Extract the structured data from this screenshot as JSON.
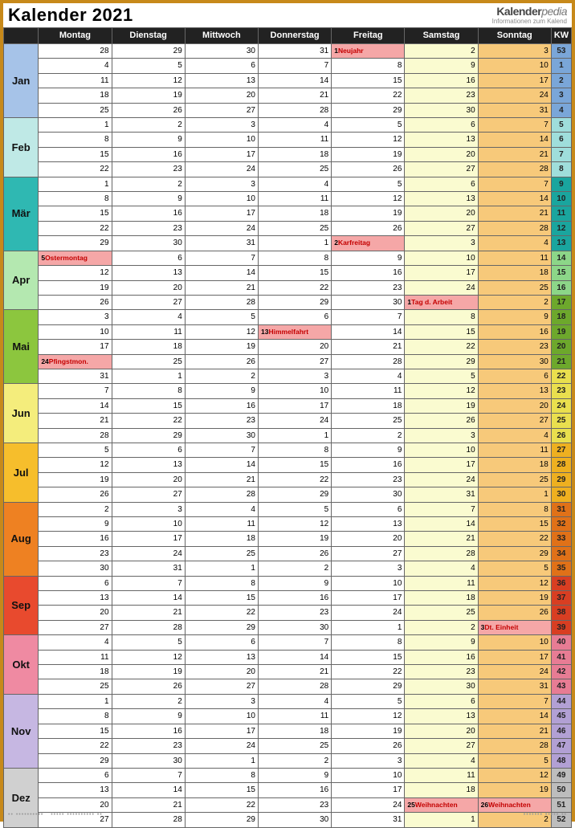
{
  "title": "Kalender 2021",
  "brand_sub": "Informationen zum Kalend",
  "columns": [
    "",
    "Montag",
    "Dienstag",
    "Mittwoch",
    "Donnerstag",
    "Freitag",
    "Samstag",
    "Sonntag",
    "KW"
  ],
  "month_colors": {
    "Jan": "#a6c3e8",
    "Feb": "#bfe9e6",
    "Mär": "#2fb8b2",
    "Apr": "#b4e8b0",
    "Mai": "#8cc63e",
    "Jun": "#f4ed7c",
    "Jul": "#f6be2c",
    "Aug": "#ee8122",
    "Sep": "#e84a2e",
    "Okt": "#ef8aa2",
    "Nov": "#c6b7e2",
    "Dez": "#d0d0d0"
  },
  "kw_colors": {
    "53": "#7aa6d8",
    "1": "#7aa6d8",
    "2": "#7aa6d8",
    "3": "#7aa6d8",
    "4": "#7aa6d8",
    "5": "#9fdedb",
    "6": "#9fdedb",
    "7": "#9fdedb",
    "8": "#9fdedb",
    "9": "#1aa59e",
    "10": "#1aa59e",
    "11": "#1aa59e",
    "12": "#1aa59e",
    "13": "#1aa59e",
    "14": "#8cd688",
    "15": "#8cd688",
    "16": "#8cd688",
    "17": "#6da82c",
    "18": "#6da82c",
    "19": "#6da82c",
    "20": "#6da82c",
    "21": "#6da82c",
    "22": "#e9df4e",
    "23": "#e9df4e",
    "24": "#e9df4e",
    "25": "#e9df4e",
    "26": "#e9df4e",
    "27": "#eeb020",
    "28": "#eeb020",
    "29": "#eeb020",
    "30": "#eeb020",
    "31": "#e07118",
    "32": "#e07118",
    "33": "#e07118",
    "34": "#e07118",
    "35": "#e07118",
    "36": "#d83e22",
    "37": "#d83e22",
    "38": "#d83e22",
    "39": "#d83e22",
    "40": "#e77c94",
    "41": "#e77c94",
    "42": "#e77c94",
    "43": "#e77c94",
    "44": "#b2a0d4",
    "45": "#b2a0d4",
    "46": "#b2a0d4",
    "47": "#b2a0d4",
    "48": "#b2a0d4",
    "49": "#bdbdbd",
    "50": "#bdbdbd",
    "51": "#bdbdbd",
    "52": "#bdbdbd"
  },
  "months": [
    {
      "name": "Jan",
      "rows": [
        {
          "d": [
            "28",
            "29",
            "30",
            "31",
            {
              "n": "1",
              "h": "Neujahr"
            },
            "2",
            "3"
          ],
          "kw": "53"
        },
        {
          "d": [
            "4",
            "5",
            "6",
            "7",
            "8",
            "9",
            "10"
          ],
          "kw": "1"
        },
        {
          "d": [
            "11",
            "12",
            "13",
            "14",
            "15",
            "16",
            "17"
          ],
          "kw": "2"
        },
        {
          "d": [
            "18",
            "19",
            "20",
            "21",
            "22",
            "23",
            "24"
          ],
          "kw": "3"
        },
        {
          "d": [
            "25",
            "26",
            "27",
            "28",
            "29",
            "30",
            "31"
          ],
          "kw": "4"
        }
      ]
    },
    {
      "name": "Feb",
      "rows": [
        {
          "d": [
            "1",
            "2",
            "3",
            "4",
            "5",
            "6",
            "7"
          ],
          "kw": "5"
        },
        {
          "d": [
            "8",
            "9",
            "10",
            "11",
            "12",
            "13",
            "14"
          ],
          "kw": "6"
        },
        {
          "d": [
            "15",
            "16",
            "17",
            "18",
            "19",
            "20",
            "21"
          ],
          "kw": "7"
        },
        {
          "d": [
            "22",
            "23",
            "24",
            "25",
            "26",
            "27",
            "28"
          ],
          "kw": "8"
        }
      ]
    },
    {
      "name": "Mär",
      "rows": [
        {
          "d": [
            "1",
            "2",
            "3",
            "4",
            "5",
            "6",
            "7"
          ],
          "kw": "9"
        },
        {
          "d": [
            "8",
            "9",
            "10",
            "11",
            "12",
            "13",
            "14"
          ],
          "kw": "10"
        },
        {
          "d": [
            "15",
            "16",
            "17",
            "18",
            "19",
            "20",
            "21"
          ],
          "kw": "11"
        },
        {
          "d": [
            "22",
            "23",
            "24",
            "25",
            "26",
            "27",
            "28"
          ],
          "kw": "12"
        },
        {
          "d": [
            "29",
            "30",
            "31",
            "1",
            {
              "n": "2",
              "h": "Karfreitag"
            },
            "3",
            "4"
          ],
          "kw": "13"
        }
      ]
    },
    {
      "name": "Apr",
      "rows": [
        {
          "d": [
            {
              "n": "5",
              "h": "Ostermontag"
            },
            "6",
            "7",
            "8",
            "9",
            "10",
            "11"
          ],
          "kw": "14"
        },
        {
          "d": [
            "12",
            "13",
            "14",
            "15",
            "16",
            "17",
            "18"
          ],
          "kw": "15"
        },
        {
          "d": [
            "19",
            "20",
            "21",
            "22",
            "23",
            "24",
            "25"
          ],
          "kw": "16"
        },
        {
          "d": [
            "26",
            "27",
            "28",
            "29",
            "30",
            {
              "n": "1",
              "h": "Tag d. Arbeit"
            },
            "2"
          ],
          "kw": "17"
        }
      ]
    },
    {
      "name": "Mai",
      "rows": [
        {
          "d": [
            "3",
            "4",
            "5",
            "6",
            "7",
            "8",
            "9"
          ],
          "kw": "18"
        },
        {
          "d": [
            "10",
            "11",
            "12",
            {
              "n": "13",
              "h": "Himmelfahrt"
            },
            "14",
            "15",
            "16"
          ],
          "kw": "19"
        },
        {
          "d": [
            "17",
            "18",
            "19",
            "20",
            "21",
            "22",
            "23"
          ],
          "kw": "20"
        },
        {
          "d": [
            {
              "n": "24",
              "h": "Pfingstmon."
            },
            "25",
            "26",
            "27",
            "28",
            "29",
            "30"
          ],
          "kw": "21"
        },
        {
          "d": [
            "31",
            "1",
            "2",
            "3",
            "4",
            "5",
            "6"
          ],
          "kw": "22"
        }
      ]
    },
    {
      "name": "Jun",
      "rows": [
        {
          "d": [
            "7",
            "8",
            "9",
            "10",
            "11",
            "12",
            "13"
          ],
          "kw": "23"
        },
        {
          "d": [
            "14",
            "15",
            "16",
            "17",
            "18",
            "19",
            "20"
          ],
          "kw": "24"
        },
        {
          "d": [
            "21",
            "22",
            "23",
            "24",
            "25",
            "26",
            "27"
          ],
          "kw": "25"
        },
        {
          "d": [
            "28",
            "29",
            "30",
            "1",
            "2",
            "3",
            "4"
          ],
          "kw": "26"
        }
      ]
    },
    {
      "name": "Jul",
      "rows": [
        {
          "d": [
            "5",
            "6",
            "7",
            "8",
            "9",
            "10",
            "11"
          ],
          "kw": "27"
        },
        {
          "d": [
            "12",
            "13",
            "14",
            "15",
            "16",
            "17",
            "18"
          ],
          "kw": "28"
        },
        {
          "d": [
            "19",
            "20",
            "21",
            "22",
            "23",
            "24",
            "25"
          ],
          "kw": "29"
        },
        {
          "d": [
            "26",
            "27",
            "28",
            "29",
            "30",
            "31",
            "1"
          ],
          "kw": "30"
        }
      ]
    },
    {
      "name": "Aug",
      "rows": [
        {
          "d": [
            "2",
            "3",
            "4",
            "5",
            "6",
            "7",
            "8"
          ],
          "kw": "31"
        },
        {
          "d": [
            "9",
            "10",
            "11",
            "12",
            "13",
            "14",
            "15"
          ],
          "kw": "32"
        },
        {
          "d": [
            "16",
            "17",
            "18",
            "19",
            "20",
            "21",
            "22"
          ],
          "kw": "33"
        },
        {
          "d": [
            "23",
            "24",
            "25",
            "26",
            "27",
            "28",
            "29"
          ],
          "kw": "34"
        },
        {
          "d": [
            "30",
            "31",
            "1",
            "2",
            "3",
            "4",
            "5"
          ],
          "kw": "35"
        }
      ]
    },
    {
      "name": "Sep",
      "rows": [
        {
          "d": [
            "6",
            "7",
            "8",
            "9",
            "10",
            "11",
            "12"
          ],
          "kw": "36"
        },
        {
          "d": [
            "13",
            "14",
            "15",
            "16",
            "17",
            "18",
            "19"
          ],
          "kw": "37"
        },
        {
          "d": [
            "20",
            "21",
            "22",
            "23",
            "24",
            "25",
            "26"
          ],
          "kw": "38"
        },
        {
          "d": [
            "27",
            "28",
            "29",
            "30",
            "1",
            "2",
            {
              "n": "3",
              "h": "Dt. Einheit"
            }
          ],
          "kw": "39"
        }
      ]
    },
    {
      "name": "Okt",
      "rows": [
        {
          "d": [
            "4",
            "5",
            "6",
            "7",
            "8",
            "9",
            "10"
          ],
          "kw": "40"
        },
        {
          "d": [
            "11",
            "12",
            "13",
            "14",
            "15",
            "16",
            "17"
          ],
          "kw": "41"
        },
        {
          "d": [
            "18",
            "19",
            "20",
            "21",
            "22",
            "23",
            "24"
          ],
          "kw": "42"
        },
        {
          "d": [
            "25",
            "26",
            "27",
            "28",
            "29",
            "30",
            "31"
          ],
          "kw": "43"
        }
      ]
    },
    {
      "name": "Nov",
      "rows": [
        {
          "d": [
            "1",
            "2",
            "3",
            "4",
            "5",
            "6",
            "7"
          ],
          "kw": "44"
        },
        {
          "d": [
            "8",
            "9",
            "10",
            "11",
            "12",
            "13",
            "14"
          ],
          "kw": "45"
        },
        {
          "d": [
            "15",
            "16",
            "17",
            "18",
            "19",
            "20",
            "21"
          ],
          "kw": "46"
        },
        {
          "d": [
            "22",
            "23",
            "24",
            "25",
            "26",
            "27",
            "28"
          ],
          "kw": "47"
        },
        {
          "d": [
            "29",
            "30",
            "1",
            "2",
            "3",
            "4",
            "5"
          ],
          "kw": "48"
        }
      ]
    },
    {
      "name": "Dez",
      "rows": [
        {
          "d": [
            "6",
            "7",
            "8",
            "9",
            "10",
            "11",
            "12"
          ],
          "kw": "49"
        },
        {
          "d": [
            "13",
            "14",
            "15",
            "16",
            "17",
            "18",
            "19"
          ],
          "kw": "50"
        },
        {
          "d": [
            "20",
            "21",
            "22",
            "23",
            "24",
            {
              "n": "25",
              "h": "Weihnachten"
            },
            {
              "n": "26",
              "h": "Weihnachten"
            }
          ],
          "kw": "51"
        },
        {
          "d": [
            "27",
            "28",
            "29",
            "30",
            "31",
            "1",
            "2"
          ],
          "kw": "52"
        }
      ]
    }
  ]
}
